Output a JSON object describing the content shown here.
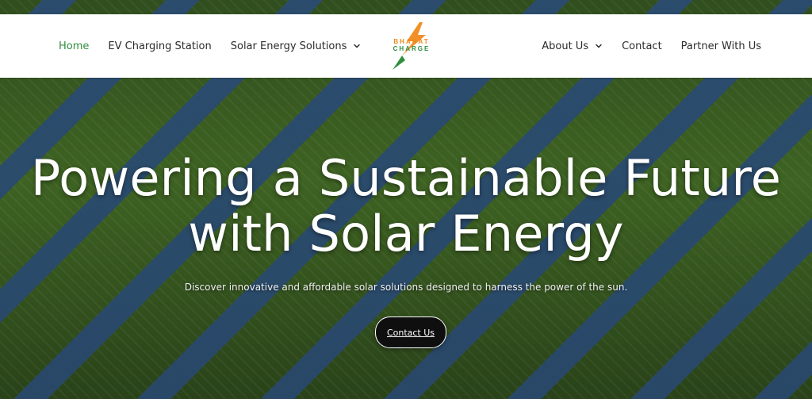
{
  "header": {
    "left_nav": [
      {
        "label": "Home",
        "active": true
      },
      {
        "label": "EV Charging Station"
      },
      {
        "label": "Solar Energy Solutions"
      }
    ],
    "right_nav": [
      {
        "label": "About Us"
      },
      {
        "label": "Contact"
      },
      {
        "label": "Partner With Us"
      }
    ],
    "logo": {
      "line1": "BHARAT",
      "line2": "CHARGE",
      "icon": "lightning-bolt-icon",
      "colors": {
        "orange": "#f08a1b",
        "green": "#2f8f3f"
      }
    }
  },
  "hero": {
    "title_line1": "Powering a Sustainable Future",
    "title_line2": "with Solar Energy",
    "subtitle": "Discover innovative and affordable solar solutions designed to harness the power of the sun.",
    "cta_label": "Contact Us",
    "background": "solar-panels-field"
  },
  "colors": {
    "active_link": "#2f8f3f",
    "text": "#2b2b2b",
    "cta_bg": "#0f0f0f"
  }
}
